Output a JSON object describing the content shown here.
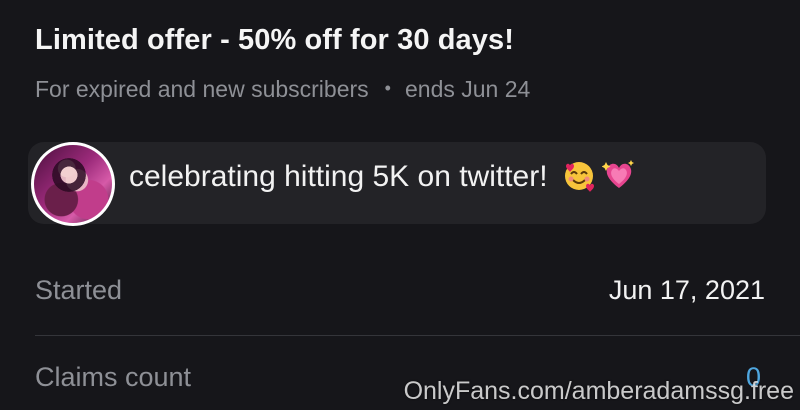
{
  "offer": {
    "title": "Limited offer - 50% off for 30 days!",
    "audience": "For expired and new subscribers",
    "separator": "•",
    "ends": "ends Jun 24"
  },
  "message": {
    "text": "celebrating hitting 5K on twitter!",
    "emojis": [
      "smiling-face-with-hearts-icon",
      "sparkling-heart-icon"
    ]
  },
  "details": {
    "started_label": "Started",
    "started_value": "Jun 17, 2021",
    "claims_label": "Claims count",
    "claims_value": "0"
  },
  "watermark": "OnlyFans.com/amberadamssg.free",
  "colors": {
    "background": "#16161a",
    "card": "#232327",
    "muted_text": "#8e9096",
    "accent": "#4fa7e0"
  }
}
